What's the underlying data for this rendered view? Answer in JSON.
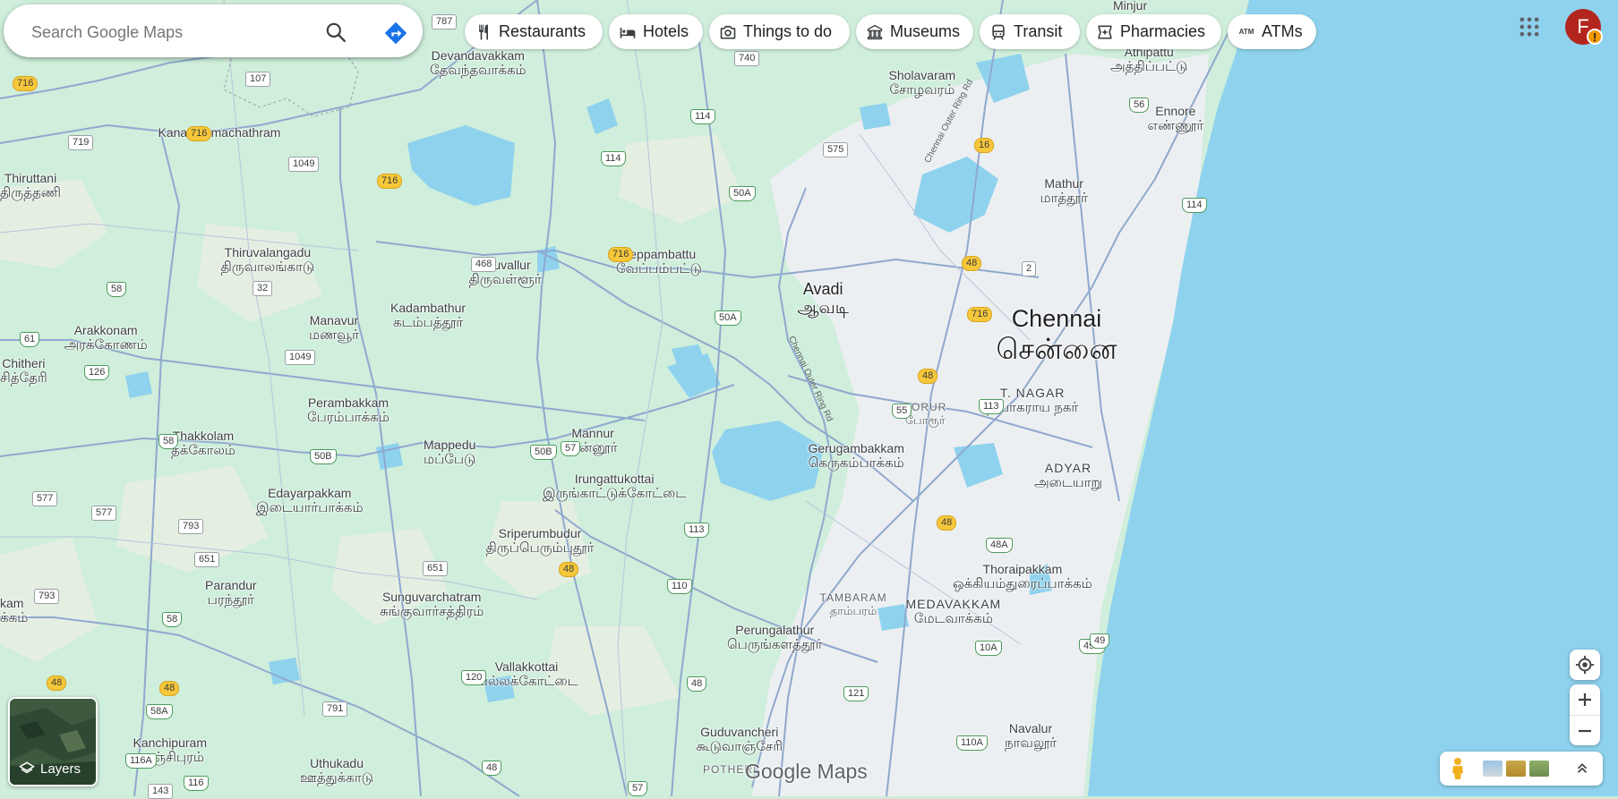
{
  "search": {
    "placeholder": "Search Google Maps"
  },
  "chips": [
    {
      "label": "Restaurants",
      "icon": "fork-knife-icon"
    },
    {
      "label": "Hotels",
      "icon": "bed-icon"
    },
    {
      "label": "Things to do",
      "icon": "camera-icon"
    },
    {
      "label": "Museums",
      "icon": "museum-icon"
    },
    {
      "label": "Transit",
      "icon": "train-icon"
    },
    {
      "label": "Pharmacies",
      "icon": "pharmacy-icon"
    },
    {
      "label": "ATMs",
      "icon": "atm-icon"
    }
  ],
  "account": {
    "initial": "F",
    "alert": "!"
  },
  "layers": {
    "label": "Layers"
  },
  "brand": {
    "text": "Google Maps"
  },
  "places": [
    {
      "en": "Devandavakkam",
      "ta": "தேவந்தவாக்கம்"
    },
    {
      "en": "Kanakammachathram",
      "ta": ""
    },
    {
      "en": "Thiruttani",
      "ta": "திருத்தணி"
    },
    {
      "en": "Thiruvalangadu",
      "ta": "திருவாலங்காடு"
    },
    {
      "en": "Tiruvallur",
      "ta": "திருவள்ளூர்"
    },
    {
      "en": "Veppambattu",
      "ta": "வேப்பம்பட்டு"
    },
    {
      "en": "Kadambathur",
      "ta": "கடம்பத்தூர்"
    },
    {
      "en": "Manavur",
      "ta": "மணவூர்"
    },
    {
      "en": "Arakkonam",
      "ta": "அரக்கோணம்"
    },
    {
      "en": "Chitheri",
      "ta": "சித்தேரி"
    },
    {
      "en": "Perambakkam",
      "ta": "பேரம்பாக்கம்"
    },
    {
      "en": "Thakkolam",
      "ta": "தக்கோலம்"
    },
    {
      "en": "Mappedu",
      "ta": "மப்பேடு"
    },
    {
      "en": "Mannur",
      "ta": "மன்னூர்"
    },
    {
      "en": "Irungattukottai",
      "ta": "இருங்காட்டுக்கோட்டை"
    },
    {
      "en": "Edayarpakkam",
      "ta": "இடையார்பாக்கம்"
    },
    {
      "en": "Sriperumbudur",
      "ta": "திருப்பெரும்புதூர்"
    },
    {
      "en": "Parandur",
      "ta": "பரந்தூர்"
    },
    {
      "en": "Sunguvarchatram",
      "ta": "சுங்குவார்சத்திரம்"
    },
    {
      "en": "Vallakkottai",
      "ta": "வல்லக்கோட்டை"
    },
    {
      "en": "Kanchipuram",
      "ta": "காஞ்சிபுரம்"
    },
    {
      "en": "Uthukadu",
      "ta": "ஊத்துக்காடு"
    },
    {
      "en": "Guduvancheri",
      "ta": "கூடுவாஞ்சேரி"
    },
    {
      "en": "Perungalathur",
      "ta": "பெருங்களத்தூர்"
    },
    {
      "en": "Sholavaram",
      "ta": "சோழவரம்"
    },
    {
      "en": "Mathur",
      "ta": "மாத்தூர்"
    },
    {
      "en": "Ennore",
      "ta": "எண்ணூர்"
    },
    {
      "en": "Athipattu",
      "ta": "அத்திப்பட்டு"
    },
    {
      "en": "Minjur",
      "ta": ""
    },
    {
      "en": "Avadi",
      "ta": "ஆவடி"
    },
    {
      "en": "Chennai",
      "ta": "சென்னை"
    },
    {
      "en": "T. NAGAR",
      "ta": "தியாகராய நகர்"
    },
    {
      "en": "PORUR",
      "ta": "போரூர்"
    },
    {
      "en": "Gerugambakkam",
      "ta": "கெருகம்பாக்கம்"
    },
    {
      "en": "ADYAR",
      "ta": "அடையாறு"
    },
    {
      "en": "Thoraipakkam",
      "ta": "ஒக்கியம்துரைப்பாக்கம்"
    },
    {
      "en": "MEDAVAKKAM",
      "ta": "மேடவாக்கம்"
    },
    {
      "en": "TAMBARAM",
      "ta": "தாம்பரம்"
    },
    {
      "en": "Navalur",
      "ta": "நாவலூர்"
    },
    {
      "en": "POTHERI",
      "ta": ""
    },
    {
      "en": "kam",
      "ta": "க்கம்"
    }
  ],
  "shields": [
    "787",
    "740",
    "716",
    "716",
    "716",
    "716",
    "716",
    "107",
    "719",
    "1049",
    "468",
    "32",
    "1049",
    "61",
    "126",
    "58",
    "58",
    "577",
    "577",
    "793",
    "651",
    "651",
    "793",
    "58",
    "48",
    "48",
    "58A",
    "791",
    "116A",
    "116",
    "143",
    "48",
    "57",
    "120",
    "48",
    "121",
    "110",
    "113",
    "48",
    "57",
    "50B",
    "50B",
    "114",
    "114",
    "50A",
    "50A",
    "575",
    "16",
    "56",
    "114",
    "2",
    "48",
    "48",
    "55",
    "113",
    "48",
    "48A",
    "10A",
    "49A",
    "49",
    "110A"
  ],
  "road_labels": [
    "Chennai Outer Ring Rd",
    "Chennai Outer Ring Rd"
  ]
}
